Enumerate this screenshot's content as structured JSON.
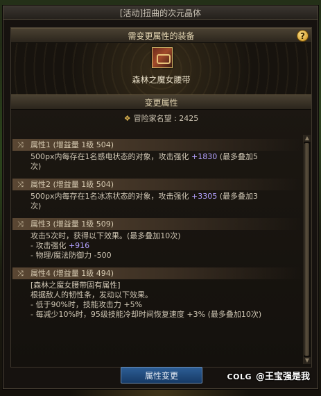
{
  "window": {
    "title": "[活动]扭曲的次元晶体"
  },
  "equip_section": {
    "header": "需变更属性的装备",
    "help_icon": "?",
    "item_name": "森林之魔女腰带"
  },
  "change_section": {
    "header": "变更属性",
    "fame_label": "冒险家名望 : 2425"
  },
  "attributes": [
    {
      "head": "属性1 (增益量 1级 504)",
      "lines": [
        {
          "pre": "500px内每存在1名感电状态的对象，攻击强化 ",
          "hl": "+1830",
          "post": " (最多叠加5"
        },
        {
          "pre": "次)",
          "hl": "",
          "post": ""
        }
      ]
    },
    {
      "head": "属性2 (增益量 1级 504)",
      "lines": [
        {
          "pre": "500px内每存在1名冰冻状态的对象，攻击强化 ",
          "hl": "+3305",
          "post": " (最多叠加3"
        },
        {
          "pre": "次)",
          "hl": "",
          "post": ""
        }
      ]
    },
    {
      "head": "属性3 (增益量 1级 509)",
      "lines": [
        {
          "pre": "攻击5次时，获得以下效果。(最多叠加10次)",
          "hl": "",
          "post": ""
        },
        {
          "pre": "- 攻击强化 ",
          "hl": "+916",
          "post": ""
        },
        {
          "pre": "- 物理/魔法防御力 -500",
          "hl": "",
          "post": ""
        }
      ]
    },
    {
      "head": "属性4 (增益量 1级 494)",
      "lines": [
        {
          "pre": "[森林之魔女腰带固有属性]",
          "hl": "",
          "post": ""
        },
        {
          "pre": "根据敌人的韧性条，发动以下效果。",
          "hl": "",
          "post": ""
        },
        {
          "pre": "- 低于90%时，技能攻击力 +5%",
          "hl": "",
          "post": ""
        },
        {
          "pre": "- 每减少10%时，95级技能冷却时间恢复速度 +3% (最多叠加10次)",
          "hl": "",
          "post": ""
        }
      ]
    }
  ],
  "footer": {
    "change_button": "属性变更",
    "watermark_logo": "COLG",
    "watermark_text": "@王宝强是我"
  },
  "colors": {
    "highlight": "#b3a1ff",
    "button": "#1f4a80",
    "accent": "#d8b04e"
  }
}
